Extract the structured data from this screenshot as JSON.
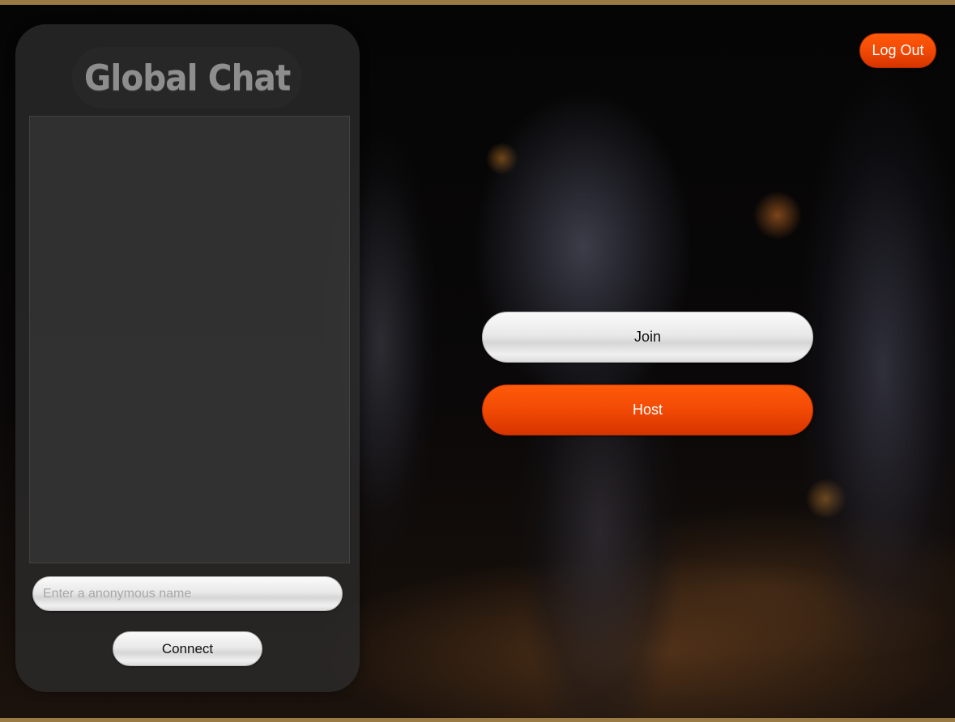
{
  "chat": {
    "title": "Global Chat",
    "name_placeholder": "Enter a anonymous name",
    "connect_label": "Connect"
  },
  "lobby": {
    "join_label": "Join",
    "host_label": "Host"
  },
  "header": {
    "logout_label": "Log Out"
  },
  "colors": {
    "accent": "#f24a05",
    "frame_border": "#9a7a45"
  }
}
